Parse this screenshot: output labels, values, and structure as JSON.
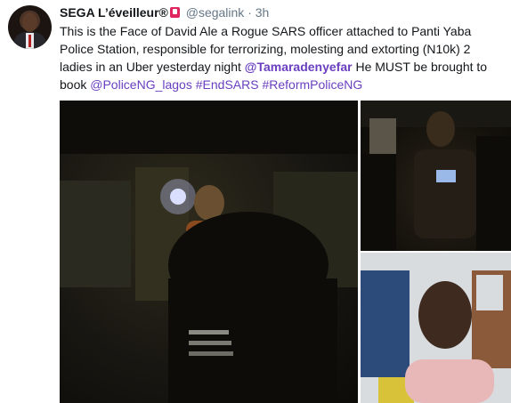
{
  "tweet": {
    "author_name": "SEGA L’éveilleur®",
    "handle": "@segalink",
    "separator": "·",
    "time": "3h",
    "text_intro": "This is the Face of David Ale a Rogue SARS officer attached to Panti Yaba Police Station, responsible for terrorizing, molesting and extorting (N10k) 2 ladies in an Uber yesterday night ",
    "mention": "@Tamaradenyefar",
    "text_mid": " He MUST be brought to book ",
    "mention2": "@PoliceNG_lagos",
    "hashtag1": "#EndSARS",
    "hashtag2": "#ReformPoliceNG"
  },
  "colors": {
    "link": "#6a3fc0",
    "text": "#14171a",
    "meta": "#657786",
    "badge": "#e0245e"
  }
}
